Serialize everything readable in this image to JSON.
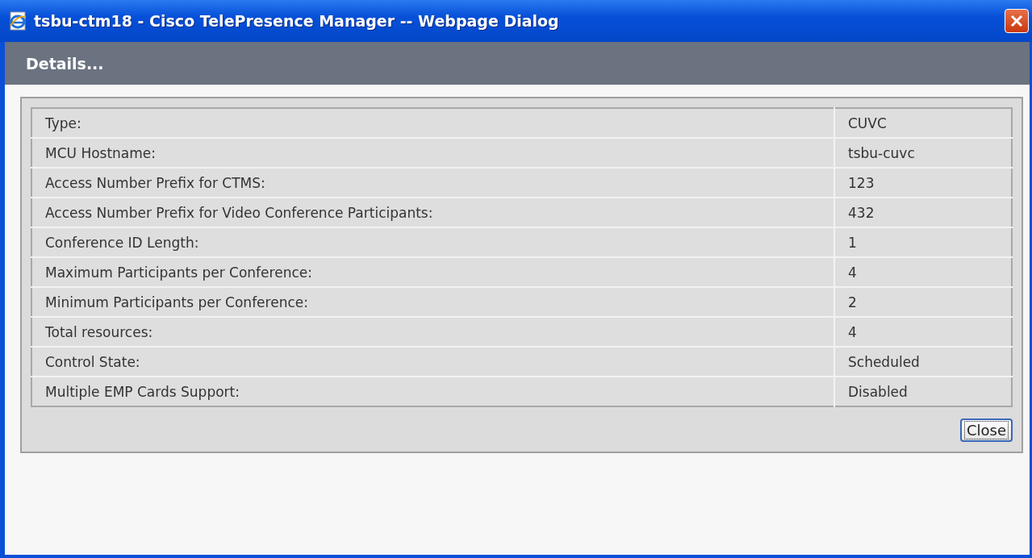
{
  "window": {
    "title": "tsbu-ctm18 - Cisco TelePresence Manager -- Webpage Dialog"
  },
  "header": "Details...",
  "rows": [
    {
      "label": "Type:",
      "value": "CUVC"
    },
    {
      "label": "MCU Hostname:",
      "value": "tsbu-cuvc"
    },
    {
      "label": "Access Number Prefix for CTMS:",
      "value": "123"
    },
    {
      "label": "Access Number Prefix for Video Conference Participants:",
      "value": "432"
    },
    {
      "label": "Conference ID Length:",
      "value": "1"
    },
    {
      "label": "Maximum Participants per Conference:",
      "value": "4"
    },
    {
      "label": "Minimum Participants per Conference:",
      "value": "2"
    },
    {
      "label": "Total resources:",
      "value": "4"
    },
    {
      "label": "Control State:",
      "value": "Scheduled"
    },
    {
      "label": "Multiple EMP Cards Support:",
      "value": "Disabled"
    }
  ],
  "buttons": [
    "Close"
  ]
}
